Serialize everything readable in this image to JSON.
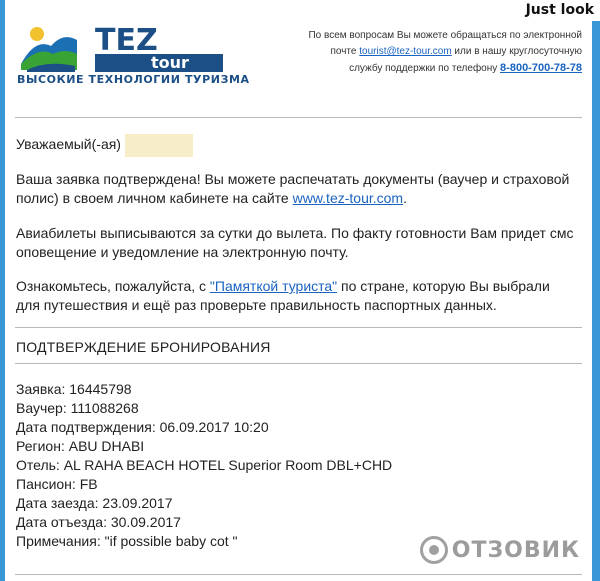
{
  "watermark_top": "Just look",
  "brand": {
    "logo_top": "TEZ",
    "logo_bottom": "tour",
    "slogan": "ВЫСОКИЕ ТЕХНОЛОГИИ ТУРИЗМА"
  },
  "contact": {
    "line1": "По всем вопросам Вы можете обращаться по электронной",
    "line2_prefix": "почте ",
    "email": "tourist@tez-tour.com",
    "line2_suffix": " или в нашу круглосуточную",
    "line3_prefix": "службу поддержки по телефону ",
    "phone": "8-800-700-78-78"
  },
  "greeting": "Уважаемый(-ая)",
  "paragraph1": {
    "text": "Ваша заявка подтверждена! Вы можете распечатать документы (ваучер и страховой полис) в своем личном кабинете на сайте ",
    "link": "www.tez-tour.com",
    "end": "."
  },
  "paragraph2": "Авиабилеты выписываются за сутки до вылета. По факту готовности Вам придет смс оповещение и уведомление на электронную почту.",
  "paragraph3": {
    "before": "Ознакомьтесь, пожалуйста, с ",
    "link": "\"Памяткой туриста\"",
    "after": " по стране, которую Вы выбрали для путешествия и ещё раз проверьте правильность паспортных данных."
  },
  "section_title": "ПОДТВЕРЖДЕНИЕ БРОНИРОВАНИЯ",
  "details": [
    "Заявка: 16445798",
    "Ваучер: 111088268",
    "Дата подтверждения: 06.09.2017 10:20",
    "Регион: ABU DHABI",
    "Отель: AL RAHA BEACH HOTEL Superior Room DBL+CHD",
    "Пансион: FB",
    "Дата заезда: 23.09.2017",
    "Дата отъезда: 30.09.2017",
    "Примечания: \"if possible baby cot \""
  ],
  "watermark_bottom": "ОТЗОВИК",
  "colors": {
    "frame": "#3b96d6",
    "link": "#1a63c0",
    "brand_blue": "#1b4f86",
    "greeting_highlight": "#f7eec9"
  }
}
